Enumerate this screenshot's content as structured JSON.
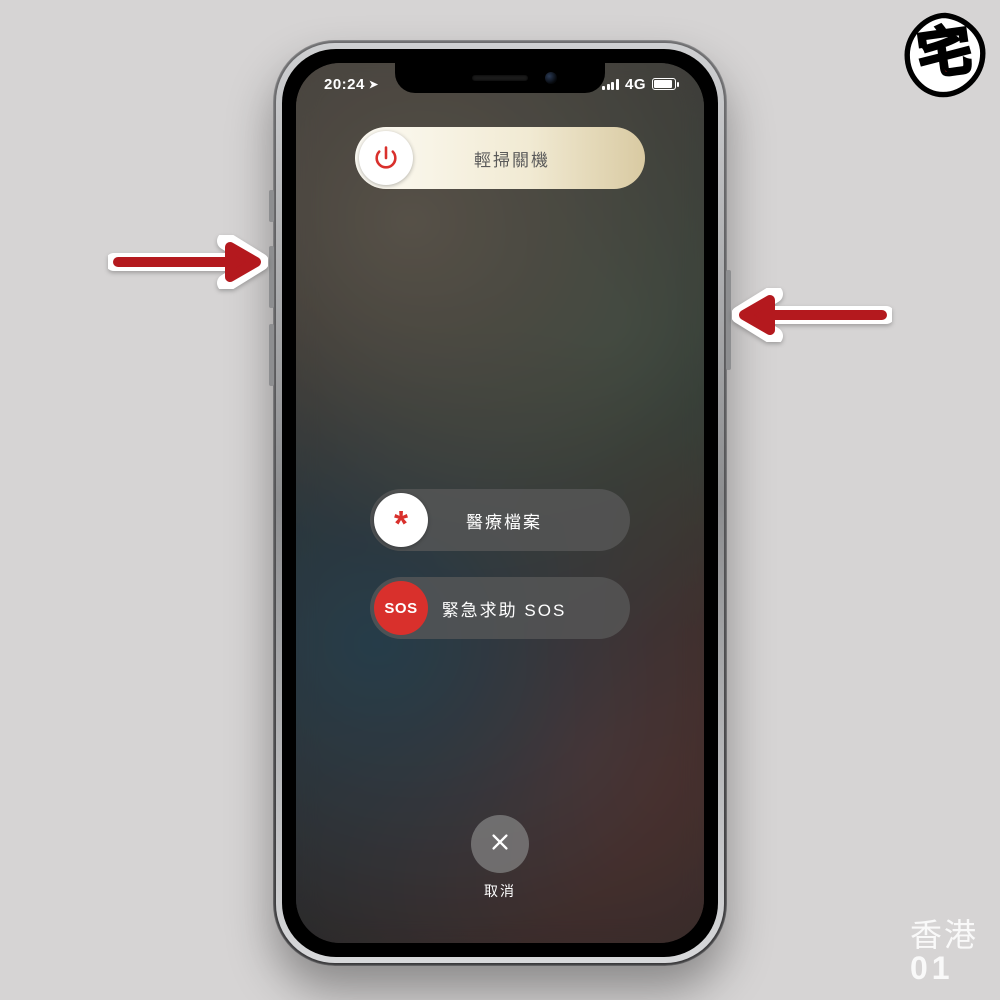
{
  "status": {
    "time": "20:24",
    "network": "4G"
  },
  "sliders": {
    "power_off": "輕掃關機",
    "medical": "醫療檔案",
    "sos": "緊急求助 SOS",
    "sos_knob": "SOS"
  },
  "cancel": "取消",
  "watermark": {
    "line1": "香港",
    "line2": "01"
  },
  "logo_char": "宅"
}
